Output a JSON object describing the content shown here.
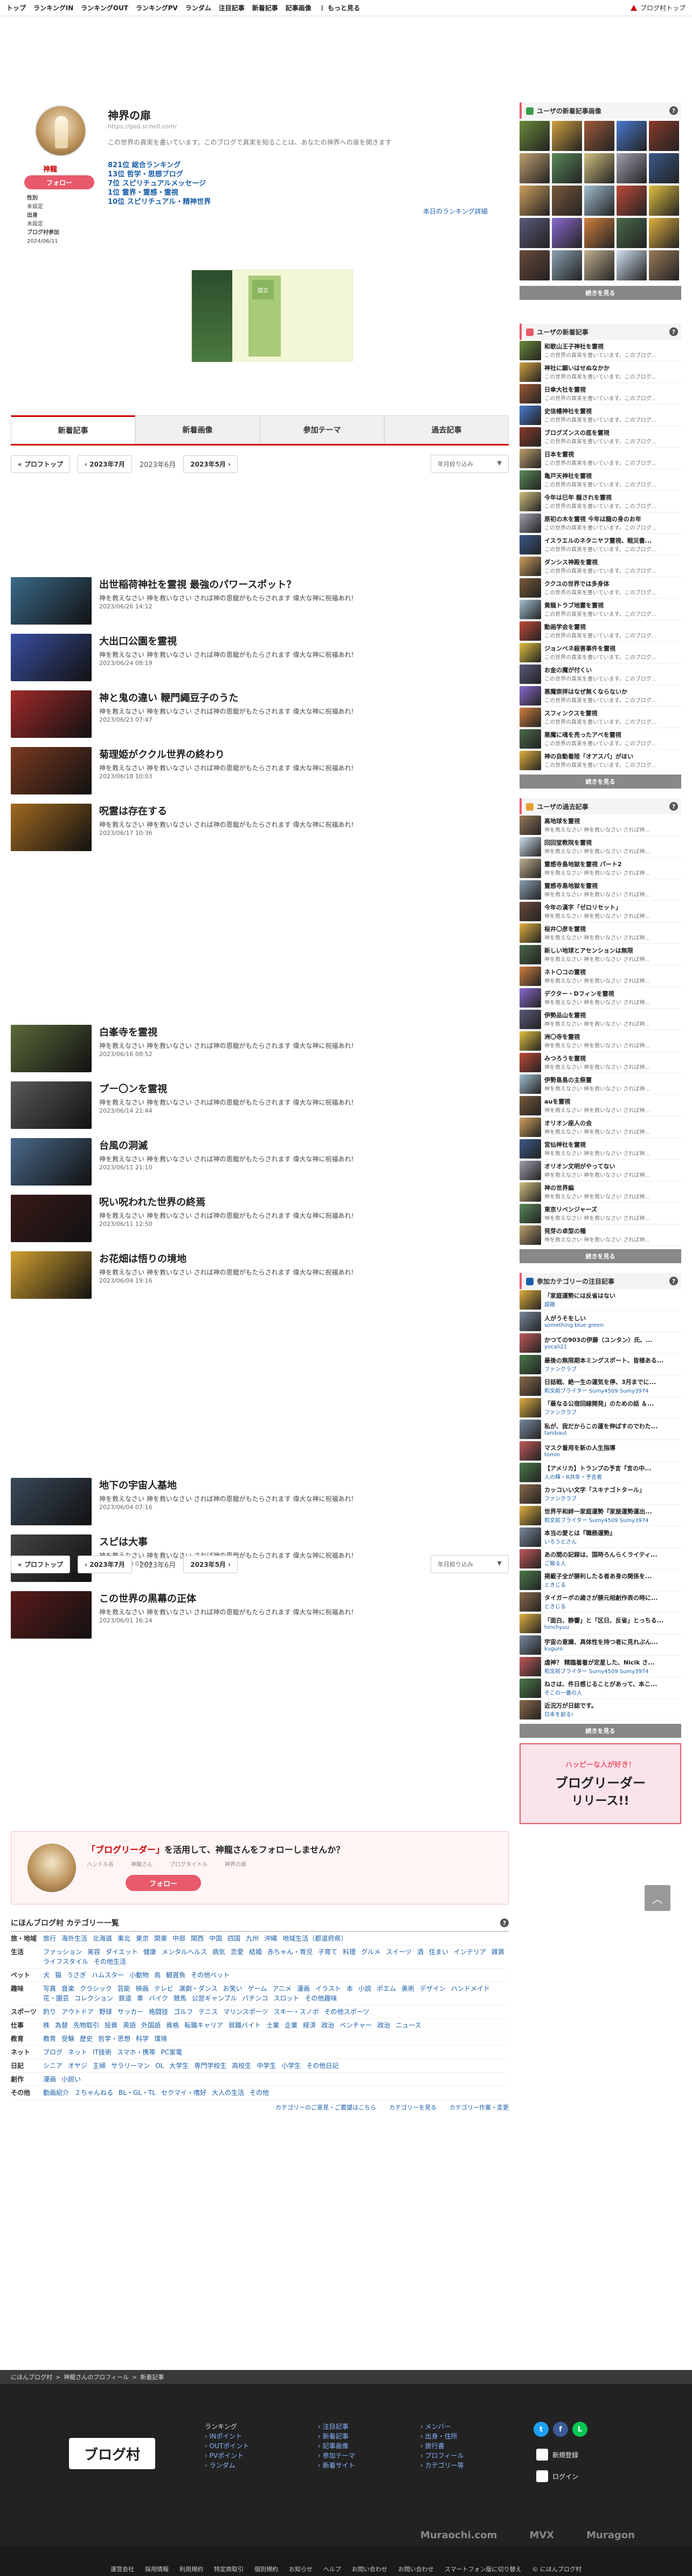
{
  "topnav": {
    "items": [
      "トップ",
      "ランキングIN",
      "ランキングOUT",
      "ランキングPV",
      "ランダム",
      "注目記事",
      "新着記事",
      "記事画像",
      "もっと見る"
    ],
    "right_label": "ブログ村トップ"
  },
  "profile": {
    "name": "神龍",
    "follow_label": "フォロー",
    "meta": {
      "gender_label": "性別",
      "gender": "未設定",
      "origin_label": "出身",
      "origin": "未設定",
      "since_label": "ブログ村参加",
      "since": "2024/06/11"
    },
    "blog_title": "神界の扉",
    "blog_url": "https://god.sr-hell.com/",
    "blog_desc": "この世界の真実を書いています。このブログで真実を知ることは、あなたの神界への扉を開きます",
    "ranks": [
      {
        "rank": "821位",
        "label": "総合ランキング"
      },
      {
        "rank": "13位",
        "label": "哲学・思想ブログ"
      },
      {
        "rank": "7位",
        "label": "スピリチュアルメッセージ"
      },
      {
        "rank": "1位",
        "label": "霊界・霊感・霊視"
      },
      {
        "rank": "10位",
        "label": "スピリチュアル・精神世界"
      }
    ],
    "rank_link": "本日のランキング詳細"
  },
  "banner": {
    "text": "国立"
  },
  "tabs": [
    "新着記事",
    "新着画像",
    "参加テーマ",
    "過去記事"
  ],
  "pager": {
    "top": "プロフトップ",
    "prev": "2023年7月",
    "current": "2023年6月",
    "next": "2023年5月",
    "select": "年月絞り込み",
    "select_arrow": "▼",
    "prev_arrow": "‹",
    "next_arrow": "›",
    "top_arrow": "«"
  },
  "articles": [
    {
      "title": "出世稲荷神社を霊視 最強のパワースポット？",
      "desc": "神を救えなさい 神を救いなさい されば神の恩寵がもたらされます 偉大な神に祝福あれ!",
      "date": "2023/06/26 14:12",
      "color": "#3a6b8a"
    },
    {
      "title": "大出口公園を霊視",
      "desc": "神を救えなさい 神を救いなさい されば神の恩寵がもたらされます 偉大な神に祝福あれ!",
      "date": "2023/06/24 08:19",
      "color": "#3a4fa0"
    },
    {
      "title": "神と鬼の違い 鞭門繩豆子のうた",
      "desc": "神を救えなさい 神を救いなさい されば神の恩寵がもたらされます 偉大な神に祝福あれ!",
      "date": "2023/06/23 07:47",
      "color": "#a02a2a"
    },
    {
      "title": "菊理姫がククル世界の終わり",
      "desc": "神を救えなさい 神を救いなさい されば神の恩寵がもたらされます 偉大な神に祝福あれ!",
      "date": "2023/06/18 10:03",
      "color": "#7a3a20"
    },
    {
      "title": "呪霊は存在する",
      "desc": "神を救えなさい 神を救いなさい されば神の恩寵がもたらされます 偉大な神に祝福あれ!",
      "date": "2023/06/17 10:36",
      "color": "#a06a20"
    },
    {
      "title": "白峯寺を霊視",
      "desc": "神を救えなさい 神を救いなさい されば神の恩寵がもたらされます 偉大な神に祝福あれ!",
      "date": "2023/06/16 08:52",
      "color": "#5a6a3a"
    },
    {
      "title": "プー〇ンを霊視",
      "desc": "神を救えなさい 神を救いなさい されば神の恩寵がもたらされます 偉大な神に祝福あれ!",
      "date": "2023/06/14 21:44",
      "color": "#5a5a5a"
    },
    {
      "title": "台風の洞滅",
      "desc": "神を救えなさい 神を救いなさい されば神の恩寵がもたらされます 偉大な神に祝福あれ!",
      "date": "2023/06/11 21:10",
      "color": "#4a6a8a"
    },
    {
      "title": "呪い呪われた世界の終焉",
      "desc": "神を救えなさい 神を救いなさい されば神の恩寵がもたらされます 偉大な神に祝福あれ!",
      "date": "2023/06/11 12:50",
      "color": "#3a1a1a"
    },
    {
      "title": "お花畑は悟りの境地",
      "desc": "神を救えなさい 神を救いなさい されば神の恩寵がもたらされます 偉大な神に祝福あれ!",
      "date": "2023/06/04 19:16",
      "color": "#d0a030"
    },
    {
      "title": "地下の宇宙人基地",
      "desc": "神を救えなさい 神を救いなさい されば神の恩寵がもたらされます 偉大な神に祝福あれ!",
      "date": "2023/06/04 07:16",
      "color": "#3a4a5a"
    },
    {
      "title": "スピは大事",
      "desc": "神を救えなさい 神を救いなさい されば神の恩寵がもたらされます 偉大な神に祝福あれ!",
      "date": "2023/06/03 07:04",
      "color": "#444444"
    },
    {
      "title": "この世界の黒幕の正体",
      "desc": "神を救えなさい 神を救いなさい されば神の恩寵がもたらされます 偉大な神に祝福あれ!",
      "date": "2023/06/01 16:24",
      "color": "#5a1a1a"
    }
  ],
  "followbox": {
    "title_quote": "「ブログリーダー」",
    "title_rest": "を活用して、神龍さんをフォローしませんか？",
    "sub": [
      "ハンドル名",
      "神龍さん",
      "ブログタイトル",
      "神界の扉"
    ],
    "btn": "フォロー"
  },
  "categories": {
    "title": "にほんブログ村 カテゴリー一覧",
    "rows": [
      {
        "name": "旅・地域",
        "items": [
          "旅行",
          "海外生活",
          "北海道",
          "東北",
          "東京",
          "関東",
          "中部",
          "関西",
          "中国",
          "四国",
          "九州",
          "沖縄",
          "地域生活（都道府県）"
        ]
      },
      {
        "name": "生活",
        "items": [
          "ファッション",
          "美容",
          "ダイエット",
          "健康",
          "メンタルヘルス",
          "病気",
          "恋愛",
          "結婚",
          "赤ちゃん・育児",
          "子育て",
          "料理",
          "グルメ",
          "スイーツ",
          "酒",
          "住まい",
          "インテリア",
          "雑貨",
          "ライフスタイル",
          "その他生活"
        ]
      },
      {
        "name": "ペット",
        "items": [
          "犬",
          "猫",
          "うさぎ",
          "ハムスター",
          "小動物",
          "鳥",
          "観賞魚",
          "その他ペット"
        ]
      },
      {
        "name": "趣味",
        "items": [
          "写真",
          "音楽",
          "クラシック",
          "芸能",
          "映画",
          "テレビ",
          "演劇・ダンス",
          "お笑い",
          "ゲーム",
          "アニメ",
          "漫画",
          "イラスト",
          "本",
          "小説",
          "ポエム",
          "美術",
          "デザイン",
          "ハンドメイド",
          "花・園芸",
          "コレクション",
          "鉄道",
          "車",
          "バイク",
          "競馬",
          "公営ギャンブル",
          "パチンコ",
          "スロット",
          "その他趣味"
        ]
      },
      {
        "name": "スポーツ",
        "items": [
          "釣り",
          "アウトドア",
          "野球",
          "サッカー",
          "格闘技",
          "ゴルフ",
          "テニス",
          "マリンスポーツ",
          "スキー・スノボ",
          "その他スポーツ"
        ]
      },
      {
        "name": "仕事",
        "items": [
          "株",
          "為替",
          "先物取引",
          "投資",
          "英語",
          "外国語",
          "資格",
          "転職キャリア",
          "就職バイト",
          "士業",
          "企業",
          "経済",
          "政治",
          "ベンチャー",
          "政治",
          "ニュース"
        ]
      },
      {
        "name": "教育",
        "items": [
          "教育",
          "受験",
          "歴史",
          "哲学・思想",
          "科学",
          "環境"
        ]
      },
      {
        "name": "ネット",
        "items": [
          "ブログ",
          "ネット",
          "IT技術",
          "スマホ・携帯",
          "PC家電"
        ]
      },
      {
        "name": "日記",
        "items": [
          "シニア",
          "オヤジ",
          "主婦",
          "サラリーマン",
          "OL",
          "大学生",
          "専門学校生",
          "高校生",
          "中学生",
          "小学生",
          "その他日記"
        ]
      },
      {
        "name": "創作",
        "items": [
          "漫画",
          "小説い"
        ]
      },
      {
        "name": "その他",
        "items": [
          "動画紹介",
          "２ちゃんねる",
          "BL・GL・TL",
          "セクマイ・嗜好",
          "大人の生活",
          "その他"
        ]
      }
    ],
    "foot": [
      "カテゴリーのご意見・ご要望はこちら",
      "カテゴリーを見る",
      "カテゴリー作業・変更"
    ]
  },
  "sidebar": {
    "images_title": "ユーザの新着記事画像",
    "images": [
      "#6a8a3a",
      "#d0a040",
      "#a05a3a",
      "#4a7ad0",
      "#8a3a2a",
      "#c0a070",
      "#5a8a5a",
      "#d0c080",
      "#a0a0b0",
      "#3a5a8a",
      "#d0a060",
      "#7a5a3a",
      "#a0c0d0",
      "#c04a3a",
      "#e0c040",
      "#5a5a7a",
      "#8a6ad0",
      "#d08040",
      "#4a6a4a",
      "#e0b040",
      "#6a4a3a",
      "#8aa0b0",
      "#c0b090",
      "#d0e0f0",
      "#9a7a5a"
    ],
    "more": "続きを見る",
    "news_title": "ユーザの新着記事",
    "news": [
      {
        "t1": "和歌山王子神社を霊視",
        "t2": "この世界の真実を書いています。このブログ..."
      },
      {
        "t1": "神社に願いはせぬなかか",
        "t2": "この世界の真実を書いています。このブログ..."
      },
      {
        "t1": "日傘大社を霊視",
        "t2": "この世界の真実を書いています。このブログ..."
      },
      {
        "t1": "史信幡神社を霊視",
        "t2": "この世界の真実を書いています。このブログ..."
      },
      {
        "t1": "ブログズンスの底を霊視",
        "t2": "この世界の真実を書いています。このブログ..."
      },
      {
        "t1": "日本を霊視",
        "t2": "この世界の真実を書いています。このブログ..."
      },
      {
        "t1": "亀戸天神社を霊視",
        "t2": "この世界の真実を書いています。このブログ..."
      },
      {
        "t1": "今年は巳年 龍されを霊視",
        "t2": "この世界の真実を書いています。このブログ..."
      },
      {
        "t1": "原初の木を霊視 今年は龍の身のお年",
        "t2": "この世界の真実を書いています。このブログ..."
      },
      {
        "t1": "イスラエルのネタニヤフ霊視、戦災書...",
        "t2": "この世界の真実を書いています。このブログ..."
      },
      {
        "t1": "ダンシス神殿を霊視",
        "t2": "この世界の真実を書いています。このブログ..."
      },
      {
        "t1": "ククユの世界では多身体",
        "t2": "この世界の真実を書いています。このブログ..."
      },
      {
        "t1": "黄龍トラブ地霊を霊視",
        "t2": "この世界の真実を書いています。このブログ..."
      },
      {
        "t1": "動画学会を霊視",
        "t2": "この世界の真実を書いています。このブログ..."
      },
      {
        "t1": "ジョンベネ殺害事件を霊視",
        "t2": "この世界の真実を書いています。このブログ..."
      },
      {
        "t1": "お金の魔が付くい",
        "t2": "この世界の真実を書いています。このブログ..."
      },
      {
        "t1": "悪魔崇拝はなぜ無くならないか",
        "t2": "この世界の真実を書いています。このブログ..."
      },
      {
        "t1": "スフィンクスを霊視",
        "t2": "この世界の真実を書いています。このブログ..."
      },
      {
        "t1": "悪魔に魂を売ったアベを霊視",
        "t2": "この世界の真実を書いています。このブログ..."
      },
      {
        "t1": "神の自動着陸「オアスパ」がほい",
        "t2": "この世界の真実を書いています。このブログ..."
      }
    ],
    "past_title": "ユーザの過去記事",
    "past": [
      {
        "t1": "高地球を霊視",
        "t2": "神を救えなさい 神を救いなさい されば神..."
      },
      {
        "t1": "回回堂教院を霊視",
        "t2": "神を救えなさい 神を救いなさい されば神..."
      },
      {
        "t1": "霊感寺島地獄を霊視 パート2",
        "t2": "神を救えなさい 神を救いなさい されば神..."
      },
      {
        "t1": "霊感寺島地獄を霊視",
        "t2": "神を救えなさい 神を救いなさい されば神..."
      },
      {
        "t1": "今年の漢字「ゼロリセット」",
        "t2": "神を救えなさい 神を救いなさい されば神..."
      },
      {
        "t1": "桜井〇彦を霊視",
        "t2": "神を救えなさい 神を救いなさい されば神..."
      },
      {
        "t1": "新しい地球とアセンションは無限",
        "t2": "神を救えなさい 神を救いなさい されば神..."
      },
      {
        "t1": "ネト〇コの霊視",
        "t2": "神を救えなさい 神を救いなさい されば神..."
      },
      {
        "t1": "デクター・Dフィンを霊視",
        "t2": "神を救えなさい 神を救いなさい されば神..."
      },
      {
        "t1": "伊勢品山を霊視",
        "t2": "神を救えなさい 神を救いなさい されば神..."
      },
      {
        "t1": "洲〇寺を霊視",
        "t2": "神を救えなさい 神を救いなさい されば神..."
      },
      {
        "t1": "みつろうを霊視",
        "t2": "神を救えなさい 神を救いなさい されば神..."
      },
      {
        "t1": "伊勢島島の主祭霊",
        "t2": "神を救えなさい 神を救いなさい されば神..."
      },
      {
        "t1": "auを霊視",
        "t2": "神を救えなさい 神を救いなさい されば神..."
      },
      {
        "t1": "オリオン座人の会",
        "t2": "神を救えなさい 神を救いなさい されば神..."
      },
      {
        "t1": "宮仙神社を霊視",
        "t2": "神を救えなさい 神を救いなさい されば神..."
      },
      {
        "t1": "オリオン文明がやってない",
        "t2": "神を救えなさい 神を救いなさい されば神..."
      },
      {
        "t1": "神の世界編",
        "t2": "神を救えなさい 神を救いなさい されば神..."
      },
      {
        "t1": "東京リベンジャーズ",
        "t2": "神を救えなさい 神を救いなさい されば神..."
      },
      {
        "t1": "発芽の卓型の種",
        "t2": "神を救えなさい 神を救いなさい されば神..."
      }
    ],
    "cat_title": "参加カテゴリーの注目記事",
    "cat": [
      {
        "t1": "「家庭運勢には反省はない",
        "t2": "超雑"
      },
      {
        "t1": "人がうそをしい",
        "t2": "something blue green"
      },
      {
        "t1": "かつての903の伊藤（ユンタン）氏、...",
        "t2": "yocali21"
      },
      {
        "t1": "最後の無限期本ミングスポート、皆様ある...",
        "t2": "ファンクラブ"
      },
      {
        "t1": "日話戦、絶一生の運気を停、3月までに...",
        "t2": "和文前ブライター Sumy4509 Sumy3974"
      },
      {
        "t1": "「最なる公宿回線開発」のための話 ＆...",
        "t2": "ファンクラブ"
      },
      {
        "t1": "私が、我だからこの運を伸ばすのでわた...",
        "t2": "tanibaut"
      },
      {
        "t1": "マスク着用を新の人生指導",
        "t2": "tomin"
      },
      {
        "t1": "【アメリカ】トランプの予言『言の中...",
        "t2": "人の輝・R共年・予言者"
      },
      {
        "t1": "カッコいい文字「スキナゴトタール」",
        "t2": "ファンクラブ"
      },
      {
        "t1": "世界平和絆一家庭運勢『家屋運勢運出...",
        "t2": "和文前ブライター Sumy4509 Sumy3974"
      },
      {
        "t1": "本当の愛とは『職務運勢』",
        "t2": "いろうとさん"
      },
      {
        "t1": "あの間の記録は、国時ろんらくライティ...",
        "t2": "ご報る人"
      },
      {
        "t1": "掲載子全が勝利したる者あ身の関係を...",
        "t2": "ときじる"
      },
      {
        "t1": "タイガーボの歳さが勝元相創作表の時に...",
        "t2": "ときじる"
      },
      {
        "t1": "「面白、静響」と「区日、反省」とっちる...",
        "t2": "hinchyuu"
      },
      {
        "t1": "宇宙の意識、具体性を持つ者に見れぶん...",
        "t2": "kuguro"
      },
      {
        "t1": "虐神？ 精臨着着が定星した、Nicik さ...",
        "t2": "和文前ブライター Sumy4509 Sumy3974"
      },
      {
        "t1": "ねさは、件日感じることがあって、本こ...",
        "t2": "そこの一番の人"
      },
      {
        "t1": "近況万が日誌です。",
        "t2": "日本を創る!"
      }
    ],
    "pr": {
      "p1": "ハッピーな人が好き！",
      "p2": "ブログリーダー",
      "p3": "リリース!!"
    }
  },
  "footer": {
    "crumb": [
      "にほんブログ村",
      "神龍さんのプロフィール",
      "新着記事"
    ],
    "logo": "ブログ村",
    "col1": [
      "ランキング",
      "INポイント",
      "OUTポイント",
      "PVポイント",
      "ランダム"
    ],
    "col2": [
      "注目記事",
      "新着記事",
      "記事画像",
      "参加テーマ",
      "新着サイト"
    ],
    "col3": [
      "メンバー",
      "出身・住所",
      "旅行書",
      "プロフィール",
      "カテゴリー等"
    ],
    "social": [
      "t",
      "f",
      "L"
    ],
    "actions": [
      "新規登録",
      "ログイン"
    ],
    "brands": [
      "Muraochi.com",
      "MVX",
      "Muragon"
    ],
    "bottom": [
      "運営会社",
      "採用情報",
      "利用規約",
      "特定商取引",
      "個別規約",
      "お知らせ",
      "ヘルプ",
      "お問い合わせ",
      "お問い合わせ",
      "スマートフォン版に切り替え",
      "© にほんブログ村"
    ]
  }
}
